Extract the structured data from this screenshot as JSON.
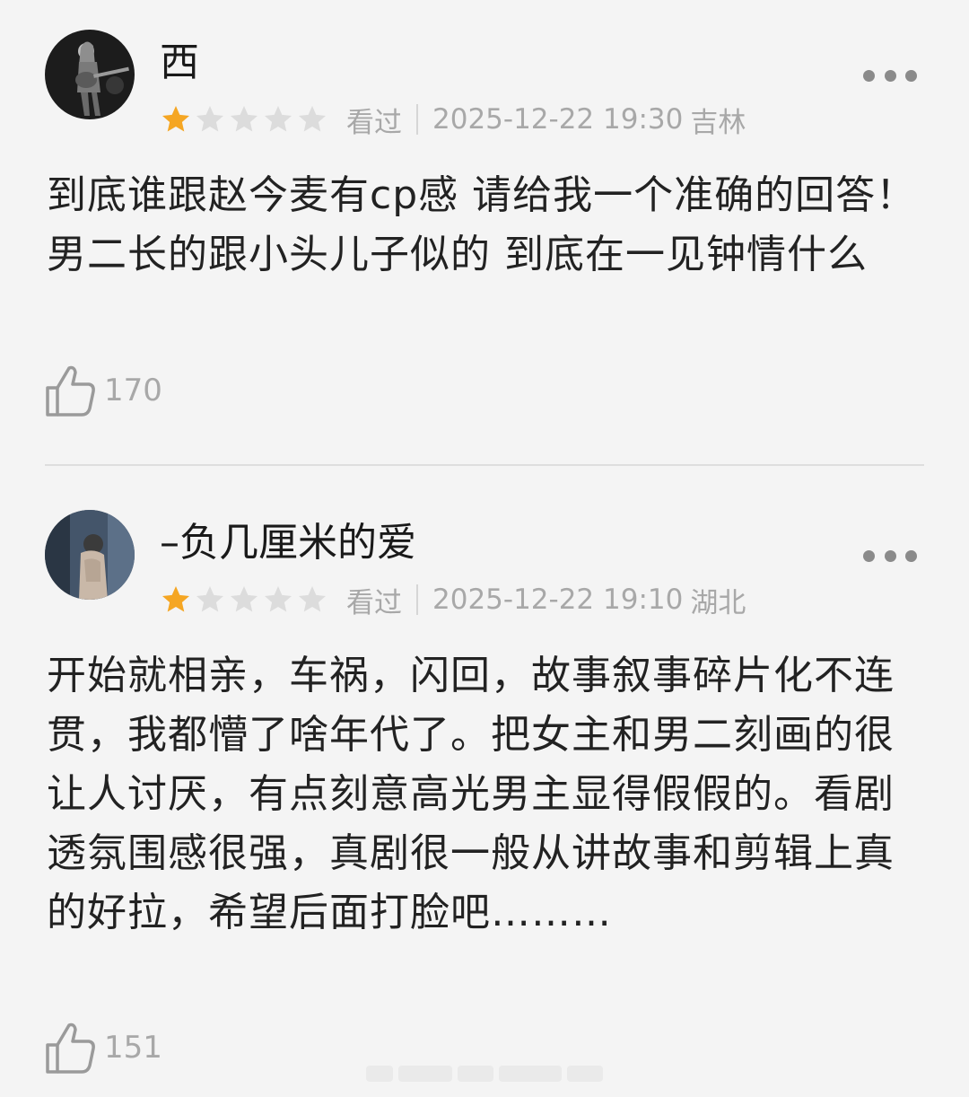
{
  "reviews": [
    {
      "username": "西",
      "rating": 1,
      "max_rating": 5,
      "status": "看过",
      "datetime": "2025-12-22 19:30",
      "location": "吉林",
      "text": "到底谁跟赵今麦有cp感 请给我一个准确的回答！男二长的跟小头儿子似的 到底在一见钟情什么",
      "likes": "170"
    },
    {
      "username": "–负几厘米的爱",
      "rating": 1,
      "max_rating": 5,
      "status": "看过",
      "datetime": "2025-12-22 19:10",
      "location": "湖北",
      "text": "开始就相亲，车祸，闪回，故事叙事碎片化不连贯，我都懵了啥年代了。把女主和男二刻画的很让人讨厌，有点刻意高光男主显得假假的。看剧透氛围感很强，真剧很一般从讲故事和剪辑上真的好拉，希望后面打脸吧………",
      "likes": "151"
    }
  ],
  "colors": {
    "star_filled": "#f5a623",
    "star_empty": "#dcdcdc",
    "meta_text": "#a8a8a8",
    "body_text": "#222222",
    "background": "#f4f4f4"
  },
  "icons": {
    "more": "more-dots-icon",
    "like": "thumbs-up-icon",
    "star": "star-icon"
  }
}
